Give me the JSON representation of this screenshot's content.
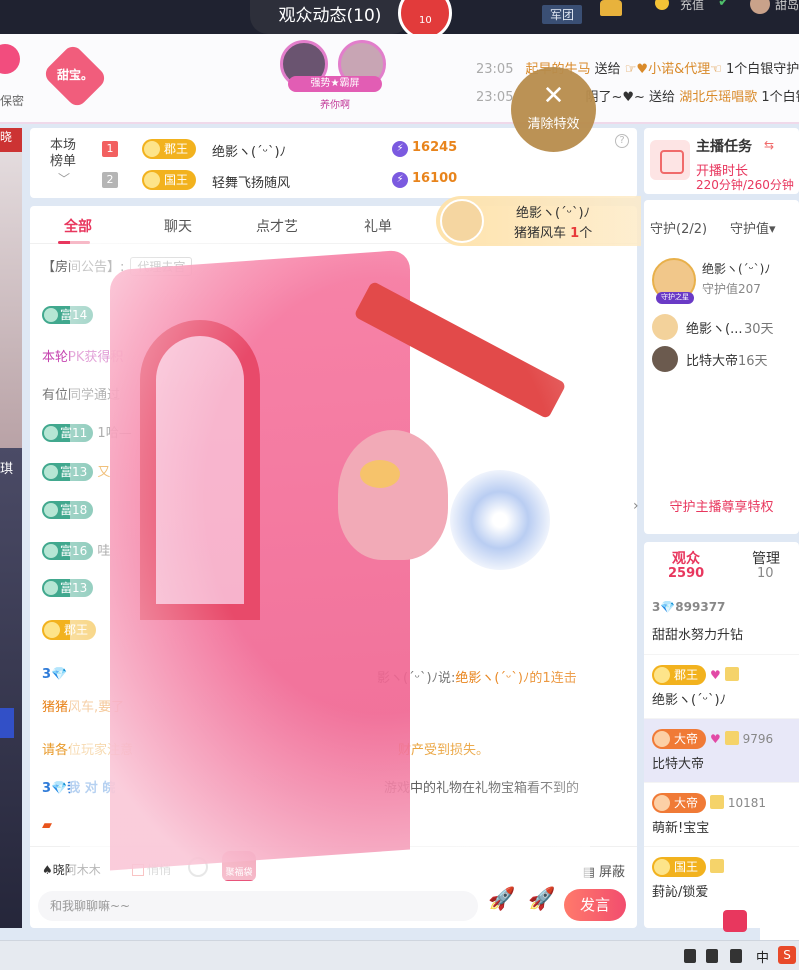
{
  "topbar": {
    "title": "观众动态(10)",
    "bubble_label": "10",
    "army_label": "军团",
    "recharge_label": "充值",
    "user_name_partial": "甜岛"
  },
  "header": {
    "secret_label": "保密",
    "badge_label": "甜宝。",
    "cp_ribbon": "强势★霸屏",
    "cp_subtitle": "养你啊",
    "gift_lines": [
      {
        "time": "23:05",
        "user": "起早的牛马",
        "action": "送给",
        "target": "☞♥小诺&代理☜",
        "gift": "1个白银守护"
      },
      {
        "time": "23:05",
        "user": "",
        "action": "阴了~♥~ 送给",
        "target": "湖北乐瑶唱歌",
        "gift": "1个白银"
      }
    ]
  },
  "clear_effect": {
    "icon": "close-icon",
    "label": "清除特效"
  },
  "left_video": {
    "badge": "晓",
    "label": "琪"
  },
  "ranking": {
    "title": "本场榜单",
    "rows": [
      {
        "rank": "1",
        "tag": "郡王",
        "name": "绝影ヽ(ˊᵕˋ)ﾉ",
        "score": "16245"
      },
      {
        "rank": "2",
        "tag": "国王",
        "name": "轻舞飞扬随风",
        "score": "16100"
      }
    ]
  },
  "chat": {
    "tabs": [
      "全部",
      "聊天",
      "点才艺",
      "礼单"
    ],
    "announcement_label": "【房间公告】:",
    "announcement_pill": "代理去官",
    "messages": {
      "m1_tag": "富14",
      "pk_text": "本轮PK获得积",
      "study_text": "有位同学通过",
      "m2_tag": "富11",
      "m2_text": "1哈—",
      "m3_tag": "富13",
      "m3_text": "又",
      "m4_tag": "富18",
      "m5_tag": "富16",
      "m5_text": "哇",
      "m6_tag": "富13",
      "jw_tag": "郡王",
      "combo_prefix": "3💎",
      "combo_mid": "影ヽ(ˊᵕˋ)ﾉ说:",
      "combo_text": "绝影ヽ(ˊᵕˋ)ﾉ的1连击",
      "combo_line2": "猪猪风车,要了",
      "warn_text": "请各位玩家注意",
      "warn_tail": "财产受到损失。",
      "reply_prefix": "3💎我 对 皖",
      "reply_text": "游戏中的礼物在礼物宝箱看不到的"
    },
    "bottom": {
      "mention": "♠晓阿木木",
      "quiet_label": "悄悄",
      "bag_label": "聚福袋",
      "shield_label": "屏蔽",
      "input_placeholder": "和我聊聊嘛~~",
      "send_label": "发言",
      "rocket1_label": "飙风"
    }
  },
  "gift_toast": {
    "user": "绝影ヽ(ˊᵕˋ)ﾉ",
    "gift": "猪猪风车",
    "count": "1",
    "unit": "个"
  },
  "right": {
    "task": {
      "title": "主播任务",
      "line1": "开播时长",
      "line2": "220分钟/260分钟"
    },
    "guard": {
      "header": "守护(2/2)",
      "header2": "守护值▾",
      "top_label": "守护之星",
      "top_name": "绝影ヽ(ˊᵕˋ)ﾉ",
      "top_value": "守护值207",
      "rows": [
        {
          "name": "绝影ヽ(...",
          "days": "30天"
        },
        {
          "name": "比特大帝",
          "days": "16天"
        }
      ],
      "privilege": "守护主播尊享特权"
    },
    "audience": {
      "tab1": "观众",
      "count1": "2590",
      "tab2": "管理",
      "count2": "10",
      "rows": [
        {
          "line1": "3💎899377",
          "line2": "甜甜水努力升钻"
        },
        {
          "line1": "郡王",
          "line2": "绝影ヽ(ˊᵕˋ)ﾉ"
        },
        {
          "line1": "大帝",
          "line1_num": "9796",
          "line2": "比特大帝"
        },
        {
          "line1": "大帝",
          "line1_num": "10181",
          "line2": "萌新!宝宝"
        },
        {
          "line1": "国王",
          "line2": "葑訫/锁爱"
        }
      ]
    }
  },
  "taskbar": {
    "ime": "中",
    "s_label": "S"
  }
}
